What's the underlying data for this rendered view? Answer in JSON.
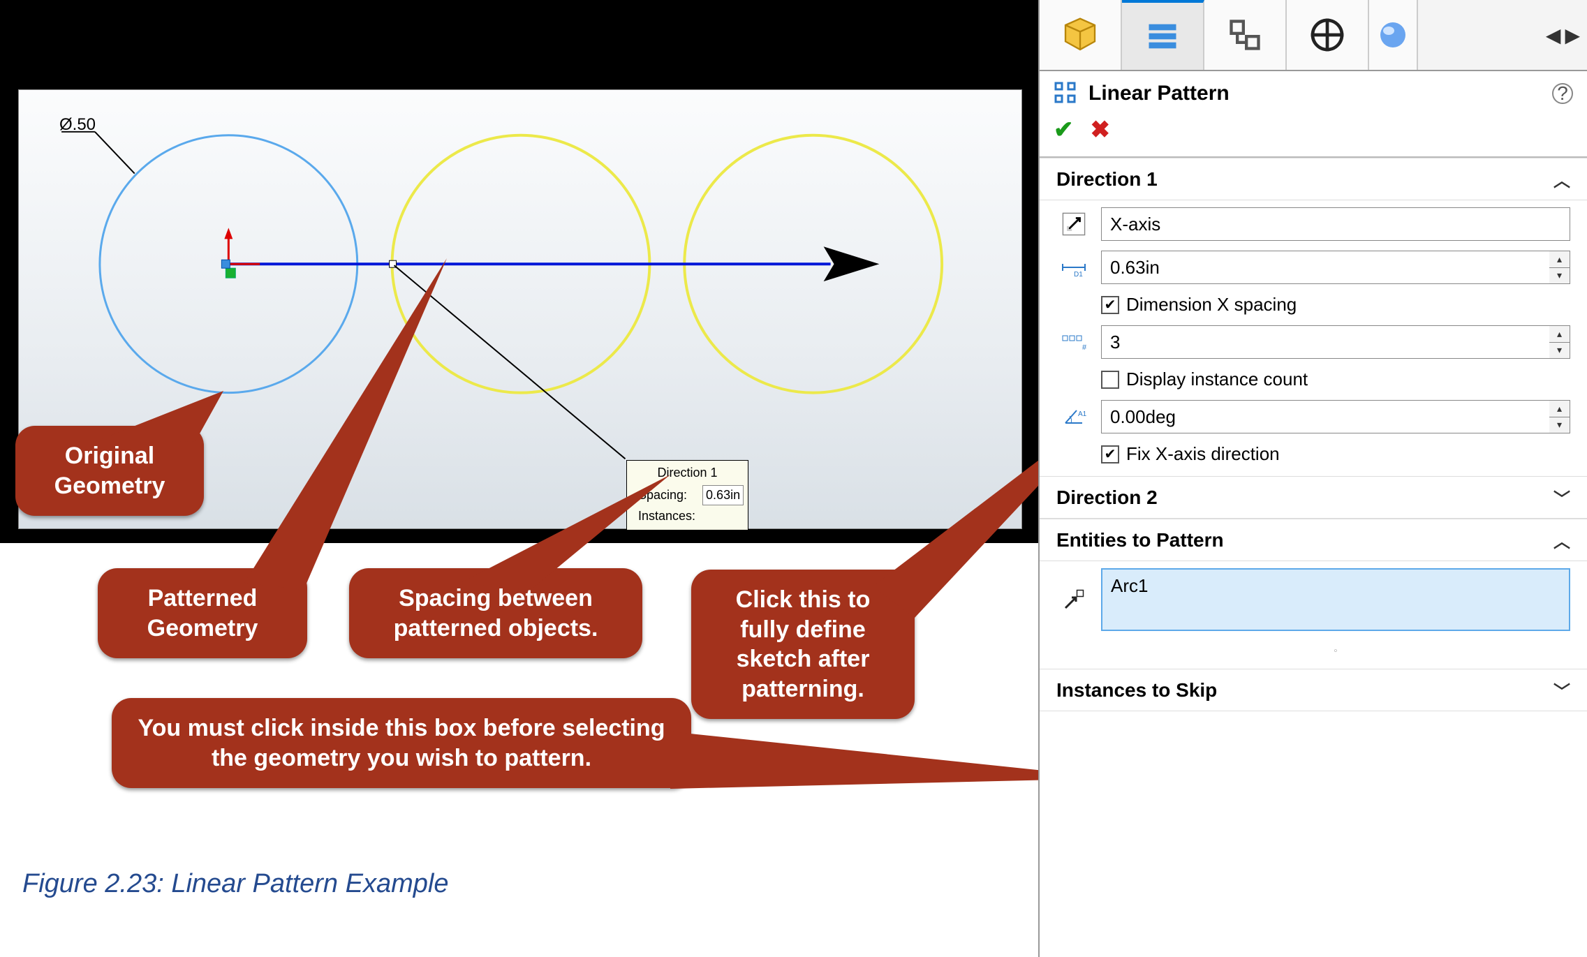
{
  "viewport": {
    "diameter_label": "Ø.50",
    "info": {
      "title": "Direction 1",
      "spacing_label": "Spacing:",
      "spacing_value": "0.63in",
      "instances_label": "Instances:"
    }
  },
  "callouts": {
    "original": "Original Geometry",
    "patterned": "Patterned Geometry",
    "spacing": "Spacing between patterned objects.",
    "dimx": "Click this to fully define sketch after patterning.",
    "entities": "You must click inside this box before selecting the geometry you wish to pattern."
  },
  "caption": "Figure 2.23: Linear Pattern Example",
  "panel": {
    "title": "Linear Pattern",
    "ok": "✔",
    "cancel": "✖",
    "dir1": {
      "header": "Direction 1",
      "axis": "X-axis",
      "spacing": "0.63in",
      "dim_x_spacing_label": "Dimension X spacing",
      "dim_x_spacing_checked": true,
      "count": "3",
      "display_instance_label": "Display instance count",
      "display_instance_checked": false,
      "angle": "0.00deg",
      "fix_x_label": "Fix X-axis direction",
      "fix_x_checked": true
    },
    "dir2": {
      "header": "Direction 2"
    },
    "entities": {
      "header": "Entities to Pattern",
      "item": "Arc1"
    },
    "skip": {
      "header": "Instances to Skip"
    }
  }
}
